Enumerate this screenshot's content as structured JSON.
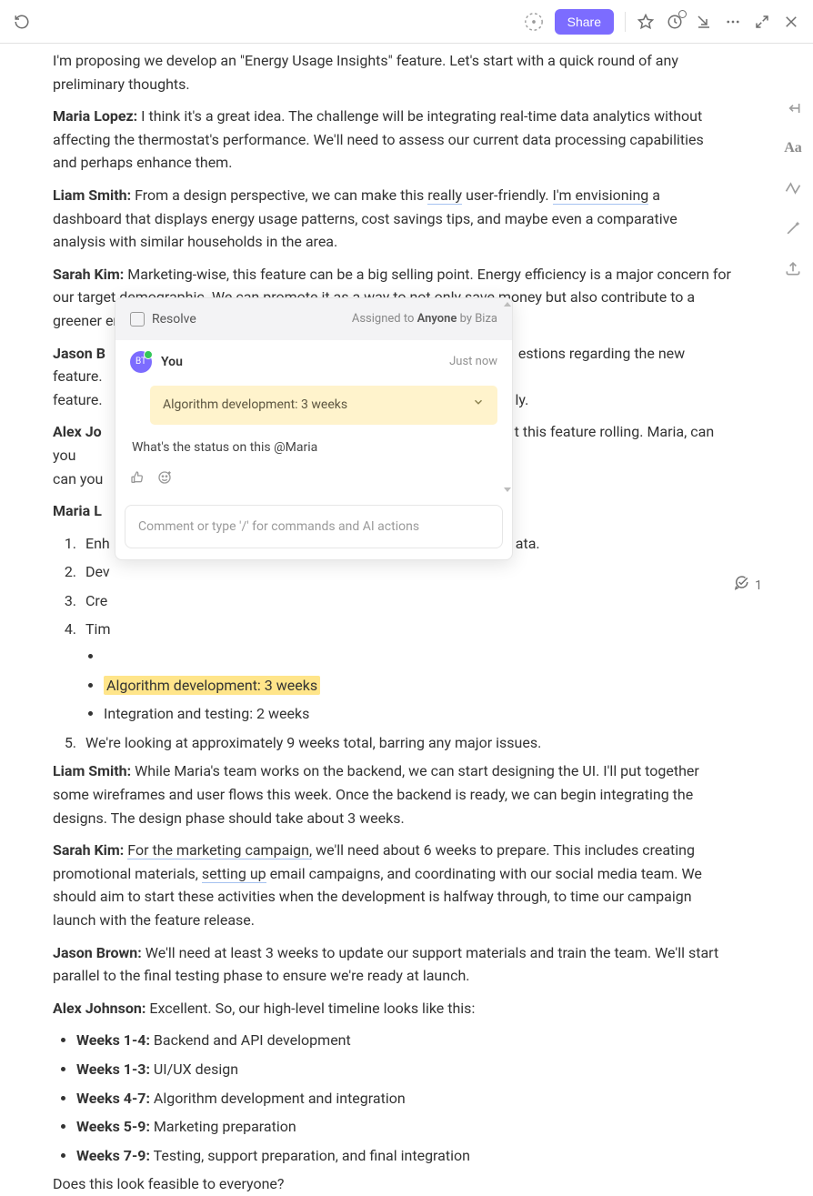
{
  "topbar": {
    "share": "Share"
  },
  "rail": {
    "aa": "Aa"
  },
  "intro": {
    "text": "I'm proposing we develop an \"Energy Usage Insights\" feature. Let's start with a quick round of any preliminary thoughts."
  },
  "p_maria1": {
    "speaker": "Maria Lopez:",
    "text": " I think it's a great idea. The challenge will be integrating real-time data analytics without affecting the thermostat's performance. We'll need to assess our current data processing capabilities and perhaps enhance them."
  },
  "p_liam1": {
    "speaker": "Liam Smith:",
    "a": " From a design perspective, we can make this ",
    "really": "really",
    "b": " user-friendly. ",
    "env": "I'm envisioning",
    "c": " a dashboard that displays energy usage patterns, cost savings tips, and maybe even a comparative analysis with similar households in the area."
  },
  "p_sarah1": {
    "speaker": "Sarah Kim:",
    "text": " Marketing-wise, this feature can be a big selling point. Energy efficiency is a major concern for our target demographic. We can promote it as a way to not only save money but also contribute to a greener environment."
  },
  "p_jason1": {
    "speaker": "Jason B",
    "tail": "estions regarding the new feature.",
    "tail2": "ly."
  },
  "p_alex1": {
    "speaker": "Alex Jo",
    "tail": "t this feature rolling. Maria, can you"
  },
  "p_maria2": {
    "speaker": "Maria L"
  },
  "list1": {
    "i1": "Enh",
    "i2": "Dev",
    "i3": "Cre",
    "i4": "Tim",
    "i5": "We're looking at approximately 9 weeks total, barring any major issues.",
    "tail_ata": "ata."
  },
  "sub": {
    "b2": "Algorithm development: 3 weeks",
    "b3": "Integration and testing: 2 weeks"
  },
  "p_liam2": {
    "speaker": "Liam Smith:",
    "text": " While Maria's team works on the backend, we can start designing the UI. I'll put together some wireframes and user flows this week. Once the backend is ready, we can begin integrating the designs. The design phase should take about 3 weeks."
  },
  "p_sarah2": {
    "speaker": "Sarah Kim:",
    "a": " ",
    "marketing": "For the marketing campaign,",
    "b": " we'll need about 6 weeks to prepare. This includes creating promotional materials, ",
    "setting": "setting up",
    "c": " email campaigns, and coordinating with our social media team. We should aim to start these activities when the development is halfway through, to time our campaign launch with the feature release."
  },
  "p_jason2": {
    "speaker": "Jason Brown:",
    "text": " We'll need at least 3 weeks to update our support materials and train the team. We'll start parallel to the final testing phase to ensure we're ready at launch."
  },
  "p_alex2": {
    "speaker": "Alex Johnson:",
    "text": " Excellent. So, our high-level timeline looks like this:"
  },
  "weeks": [
    {
      "w": "Weeks 1-4:",
      "t": " Backend and API development"
    },
    {
      "w": "Weeks 1-3:",
      "t": " UI/UX design"
    },
    {
      "w": "Weeks 4-7:",
      "t": " Algorithm development and integration"
    },
    {
      "w": "Weeks 5-9:",
      "t": " Marketing preparation"
    },
    {
      "w": "Weeks 7-9:",
      "t": " Testing, support preparation, and final integration"
    }
  ],
  "closer": "Does this look feasible to everyone?",
  "pop": {
    "resolve": "Resolve",
    "assigned_to": "Assigned to ",
    "anyone": "Anyone",
    "by": "  by Biza",
    "avatar": "BT",
    "you": "You",
    "time": "Just now",
    "snippet": "Algorithm development: 3 weeks",
    "comment": "What's the status on this @Maria",
    "placeholder": "Comment or type '/' for commands and AI actions"
  },
  "margin": {
    "count": "1"
  }
}
